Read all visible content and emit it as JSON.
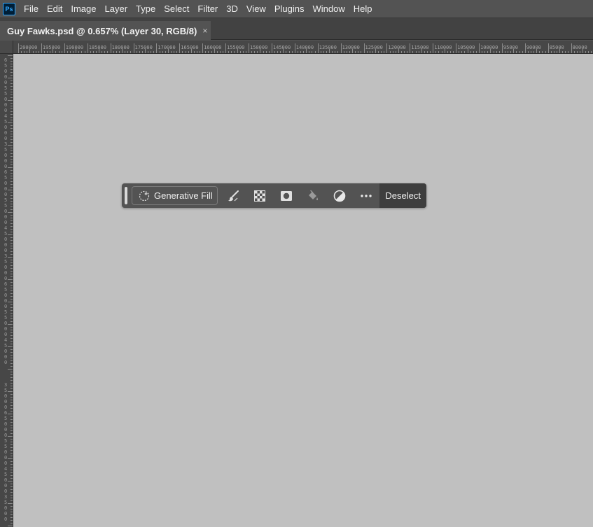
{
  "app": {
    "logo_text": "Ps"
  },
  "menu": [
    "File",
    "Edit",
    "Image",
    "Layer",
    "Type",
    "Select",
    "Filter",
    "3D",
    "View",
    "Plugins",
    "Window",
    "Help"
  ],
  "document_tab": {
    "title": "Guy Fawks.psd @ 0.657% (Layer 30, RGB/8)",
    "close": "×"
  },
  "ruler_top_labels": [
    "200000",
    "195000",
    "190000",
    "185000",
    "180000",
    "175000",
    "170000",
    "165000",
    "160000",
    "155000",
    "150000",
    "145000",
    "140000",
    "135000",
    "130000",
    "125000",
    "120000",
    "115000",
    "110000",
    "105000",
    "100000",
    "95000",
    "90000",
    "85000",
    "80000"
  ],
  "contextual_taskbar": {
    "generative_fill_label": "Generative Fill",
    "icons": [
      "brush-selection-icon",
      "checkerboard-transparency-icon",
      "layer-mask-icon",
      "paint-bucket-icon",
      "adjustment-circle-icon",
      "more-options-icon"
    ],
    "deselect_label": "Deselect"
  },
  "colors": {
    "canvas": "#c0c0c0",
    "chrome": "#535353",
    "accent": "#31a8ff"
  }
}
